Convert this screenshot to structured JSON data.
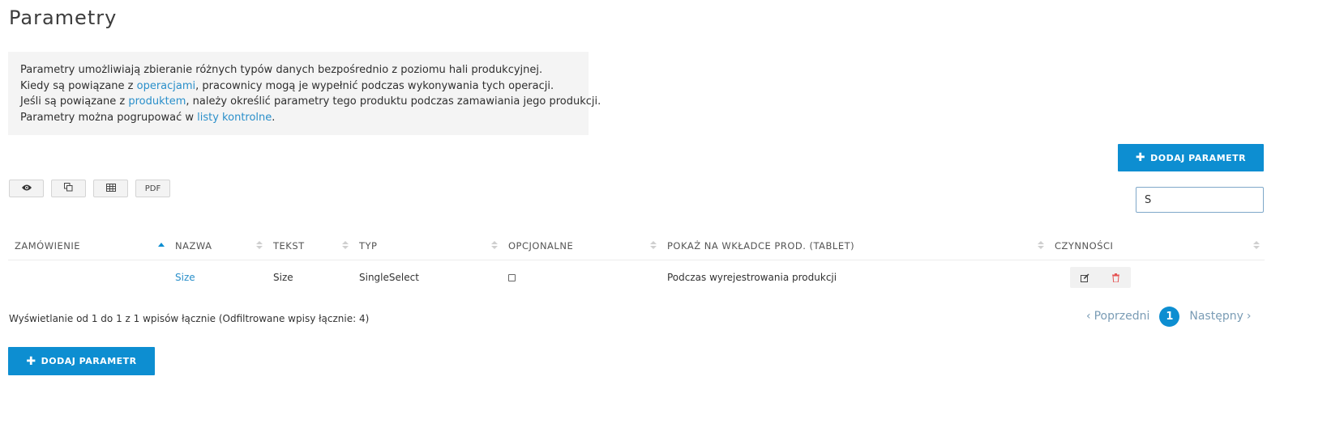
{
  "page": {
    "title": "Parametry"
  },
  "info": {
    "line1": "Parametry umożliwiają zbieranie różnych typów danych bezpośrednio z poziomu hali produkcyjnej.",
    "line2_pre": "Kiedy są powiązane z ",
    "line2_link": "operacjami",
    "line2_post": ", pracownicy mogą je wypełnić podczas wykonywania tych operacji.",
    "line3_pre": "Jeśli są powiązane z ",
    "line3_link": "produktem",
    "line3_post": ", należy określić parametry tego produktu podczas zamawiania jego produkcji.",
    "line4_pre": "Parametry można pogrupować w ",
    "line4_link": "listy kontrolne",
    "line4_post": "."
  },
  "add_button_label": "DODAJ PARAMETR",
  "toolbar": {
    "buttons": [
      {
        "icon": "eye-icon"
      },
      {
        "icon": "copy-icon"
      },
      {
        "icon": "table-icon"
      },
      {
        "label": "PDF"
      }
    ]
  },
  "search": {
    "value": "S"
  },
  "table": {
    "columns": [
      "ZAMÓWIENIE",
      "NAZWA",
      "TEKST",
      "TYP",
      "OPCJONALNE",
      "POKAŻ NA WKŁADCE PROD. (TABLET)",
      "CZYNNOŚCI"
    ],
    "sorted_column": "ZAMÓWIENIE",
    "rows": [
      {
        "order": "",
        "name": "Size",
        "text": "Size",
        "type": "SingleSelect",
        "optional": false,
        "show_on_tablet": "Podczas wyrejestrowania produkcji"
      }
    ]
  },
  "status": "Wyświetlanie od 1 do 1 z 1 wpisów łącznie (Odfiltrowane wpisy łącznie: 4)",
  "pagination": {
    "prev": "Poprzedni",
    "current": "1",
    "next": "Następny"
  },
  "colors": {
    "accent": "#0d8ed1",
    "link": "#2a8fca",
    "danger": "#e55353"
  }
}
